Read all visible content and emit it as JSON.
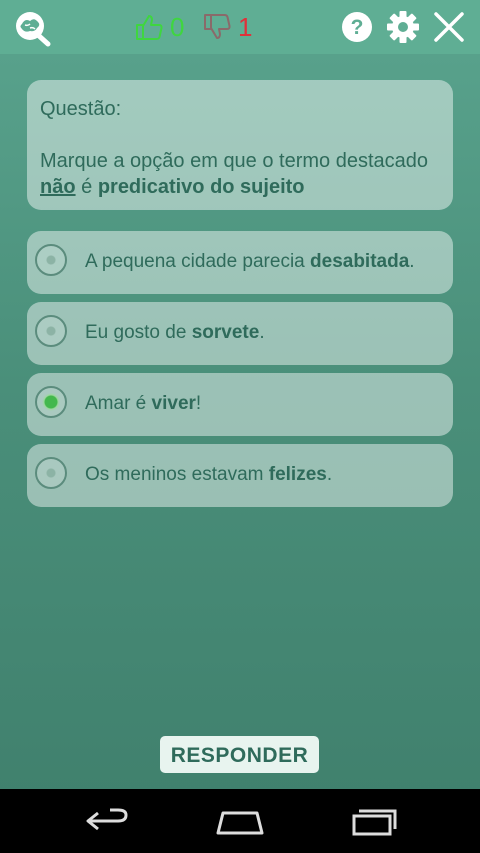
{
  "header": {
    "likes": "0",
    "dislikes": "1",
    "icons": [
      "brain-search-logo",
      "thumbs-up-icon",
      "thumbs-down-icon",
      "help-icon",
      "gear-icon",
      "close-icon"
    ],
    "colors": {
      "likes": "#3fd63f",
      "dislikes": "#e0313a",
      "topbar": "#5fae94"
    }
  },
  "question": {
    "label": "Questão:",
    "text_part1": "Marque a opção em que o termo destacado ",
    "text_emph": "não",
    "text_part2": " é ",
    "text_bold": "predicativo do sujeito"
  },
  "options": [
    {
      "prefix": "A pequena cidade parecia ",
      "highlight": "desabitada",
      "suffix": ".",
      "selected": false
    },
    {
      "prefix": "Eu gosto de ",
      "highlight": "sorvete",
      "suffix": ".",
      "selected": false
    },
    {
      "prefix": "Amar é ",
      "highlight": "viver",
      "suffix": "!",
      "selected": true
    },
    {
      "prefix": "Os meninos estavam ",
      "highlight": "felizes",
      "suffix": ".",
      "selected": false
    }
  ],
  "actions": {
    "respond_label": "RESPONDER"
  },
  "navbar": {
    "icons": [
      "back-icon",
      "home-icon",
      "recent-apps-icon"
    ]
  }
}
